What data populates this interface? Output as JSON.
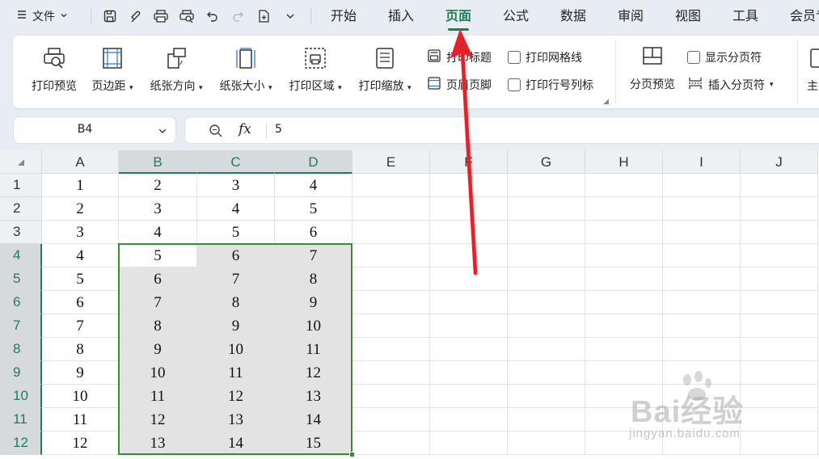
{
  "menu": {
    "file_label": "文件",
    "tabs": [
      "开始",
      "插入",
      "页面",
      "公式",
      "数据",
      "审阅",
      "视图",
      "工具",
      "会员专"
    ],
    "active_tab": "页面"
  },
  "ribbon": {
    "print_preview": "打印预览",
    "margins": "页边距",
    "orientation": "纸张方向",
    "paper_size": "纸张大小",
    "print_area": "打印区域",
    "print_scale": "打印缩放",
    "print_titles": "打印标题",
    "header_footer": "页眉页脚",
    "print_gridlines": "打印网格线",
    "print_row_col_headers": "打印行号列标",
    "page_break_preview": "分页预览",
    "show_page_breaks": "显示分页符",
    "insert_page_break": "插入分页符",
    "theme_partial": "主"
  },
  "formula_bar": {
    "cell_ref": "B4",
    "fx_label": "fx",
    "value": "5"
  },
  "sheet": {
    "columns": [
      "A",
      "B",
      "C",
      "D",
      "E",
      "F",
      "G",
      "H",
      "I",
      "J"
    ],
    "rows": [
      "1",
      "2",
      "3",
      "4",
      "5",
      "6",
      "7",
      "8",
      "9",
      "10",
      "11",
      "12"
    ],
    "data": [
      [
        "1",
        "2",
        "3",
        "4"
      ],
      [
        "2",
        "3",
        "4",
        "5"
      ],
      [
        "3",
        "4",
        "5",
        "6"
      ],
      [
        "4",
        "5",
        "6",
        "7"
      ],
      [
        "5",
        "6",
        "7",
        "8"
      ],
      [
        "6",
        "7",
        "8",
        "9"
      ],
      [
        "7",
        "8",
        "9",
        "10"
      ],
      [
        "8",
        "9",
        "10",
        "11"
      ],
      [
        "9",
        "10",
        "11",
        "12"
      ],
      [
        "10",
        "11",
        "12",
        "13"
      ],
      [
        "11",
        "12",
        "13",
        "14"
      ],
      [
        "12",
        "13",
        "14",
        "15"
      ]
    ],
    "selection": "B4:D12",
    "active_cell": "B4"
  },
  "colors": {
    "accent": "#1e7e53",
    "selection_border": "#3a8a3a",
    "annotation_arrow": "#e0202a"
  },
  "watermark": {
    "logo": "Bai经验",
    "sub": "jingyan.baidu.com"
  }
}
